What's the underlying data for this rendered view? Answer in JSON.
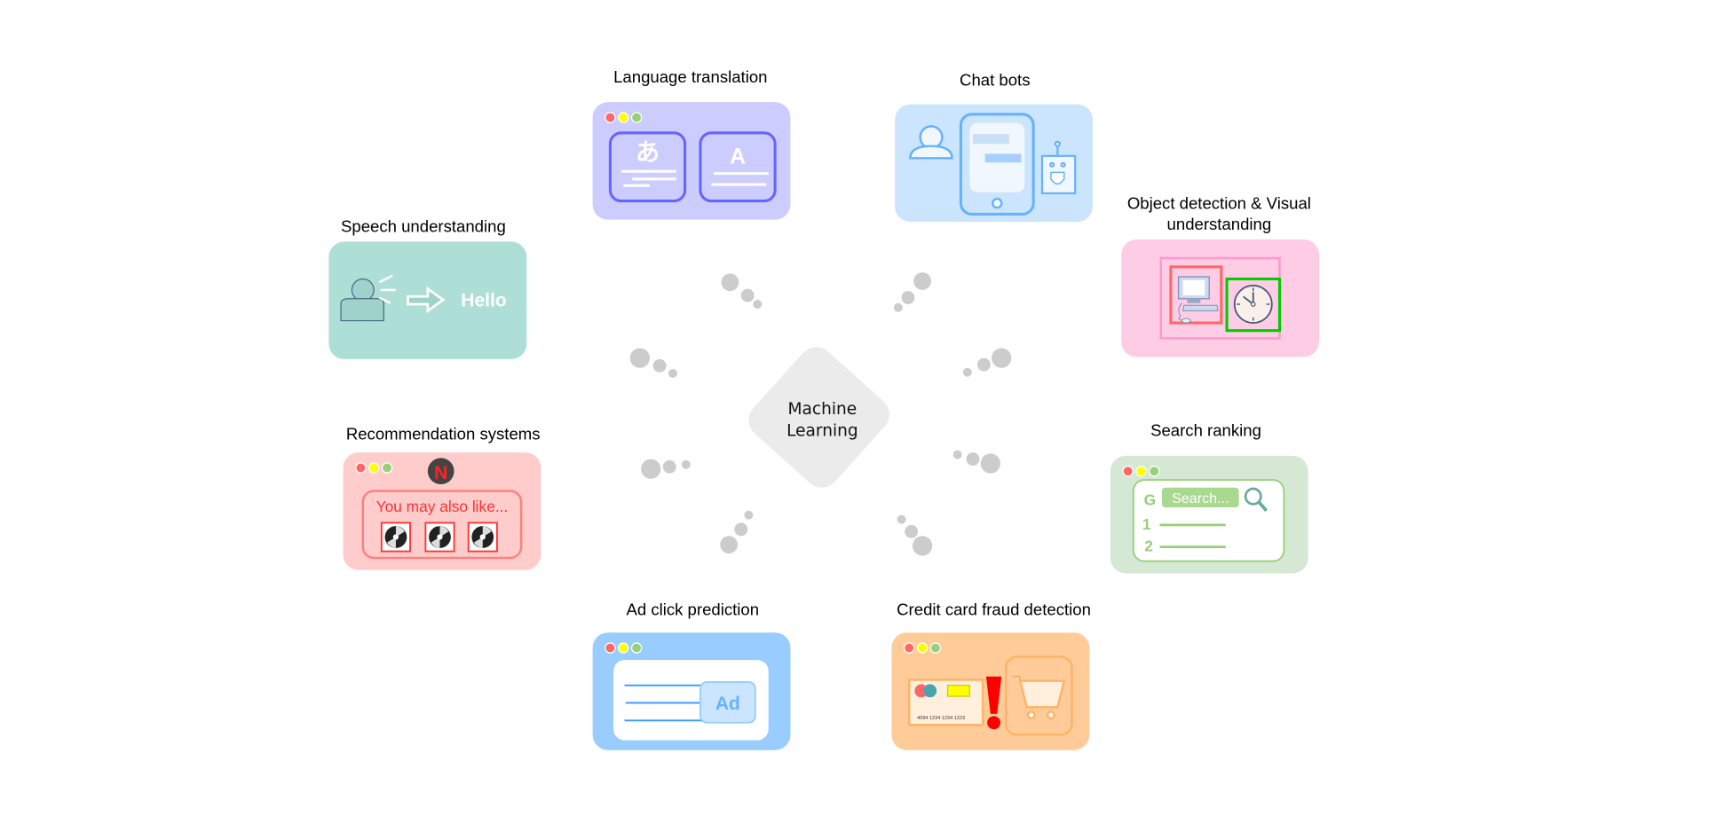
{
  "center": {
    "line1": "Machine",
    "line2": "Learning"
  },
  "cards": {
    "language": {
      "label": "Language translation",
      "glyph_source": "あ",
      "glyph_target": "A",
      "bg": "#ccccff"
    },
    "chat": {
      "label": "Chat bots",
      "bg": "#cce5ff"
    },
    "object": {
      "label_line1": "Object detection & Visual",
      "label_line2": "understanding",
      "bg": "#ffcce6"
    },
    "speech": {
      "label": "Speech understanding",
      "text": "Hello",
      "bg": "#aedfd6"
    },
    "recommendation": {
      "label": "Recommendation systems",
      "logo": "N",
      "text": "You may also like...",
      "bg": "#ffcccc"
    },
    "search": {
      "label": "Search ranking",
      "logo": "G",
      "search_text": "Search...",
      "rank1": "1",
      "rank2": "2",
      "bg": "#d5e8d4"
    },
    "ad": {
      "label": "Ad click prediction",
      "ad_text": "Ad",
      "bg": "#99ccff"
    },
    "fraud": {
      "label": "Credit card fraud detection",
      "card_number": "4094 1234 1234 1223",
      "alert": "!",
      "bg": "#ffcc99"
    }
  },
  "colors": {
    "dots": "#cccccc",
    "diamond": "#ebebeb",
    "traffic_red": "#ff6666",
    "traffic_yellow": "#ffff00",
    "traffic_green": "#97d077"
  }
}
